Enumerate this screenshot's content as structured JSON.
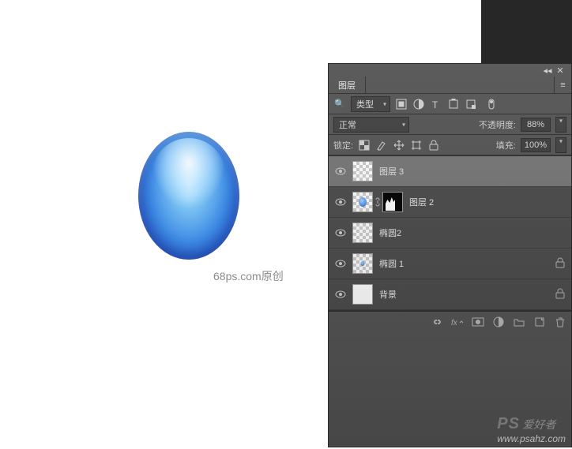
{
  "canvas": {
    "credit": "68ps.com原创",
    "wm_big": "PS",
    "wm_cn": "爱好者",
    "wm_url": "www.psahz.com"
  },
  "panel": {
    "title_tab": "图层",
    "filter_select": "类型",
    "blend_select": "正常",
    "opacity_label": "不透明度:",
    "opacity_value": "88%",
    "lock_label": "锁定:",
    "fill_label": "填充:",
    "fill_value": "100%",
    "icons": {
      "search": "🔍",
      "collapse": "◂◂",
      "close": "✕",
      "menu": "≡"
    },
    "layers": [
      {
        "name": "图层 3",
        "locked": false,
        "thumbs": [
          "checker"
        ],
        "selected": true
      },
      {
        "name": "图层 2",
        "locked": false,
        "thumbs": [
          "dot",
          "link",
          "mask"
        ],
        "selected": false
      },
      {
        "name": "椭圆2",
        "locked": false,
        "thumbs": [
          "checker"
        ],
        "selected": false
      },
      {
        "name": "椭圆 1",
        "locked": true,
        "thumbs": [
          "dot"
        ],
        "selected": false
      },
      {
        "name": "背景",
        "locked": true,
        "thumbs": [
          "white"
        ],
        "selected": false
      }
    ],
    "footer_icons": [
      "link",
      "fx",
      "mask",
      "adjust",
      "group",
      "new",
      "trash"
    ]
  }
}
